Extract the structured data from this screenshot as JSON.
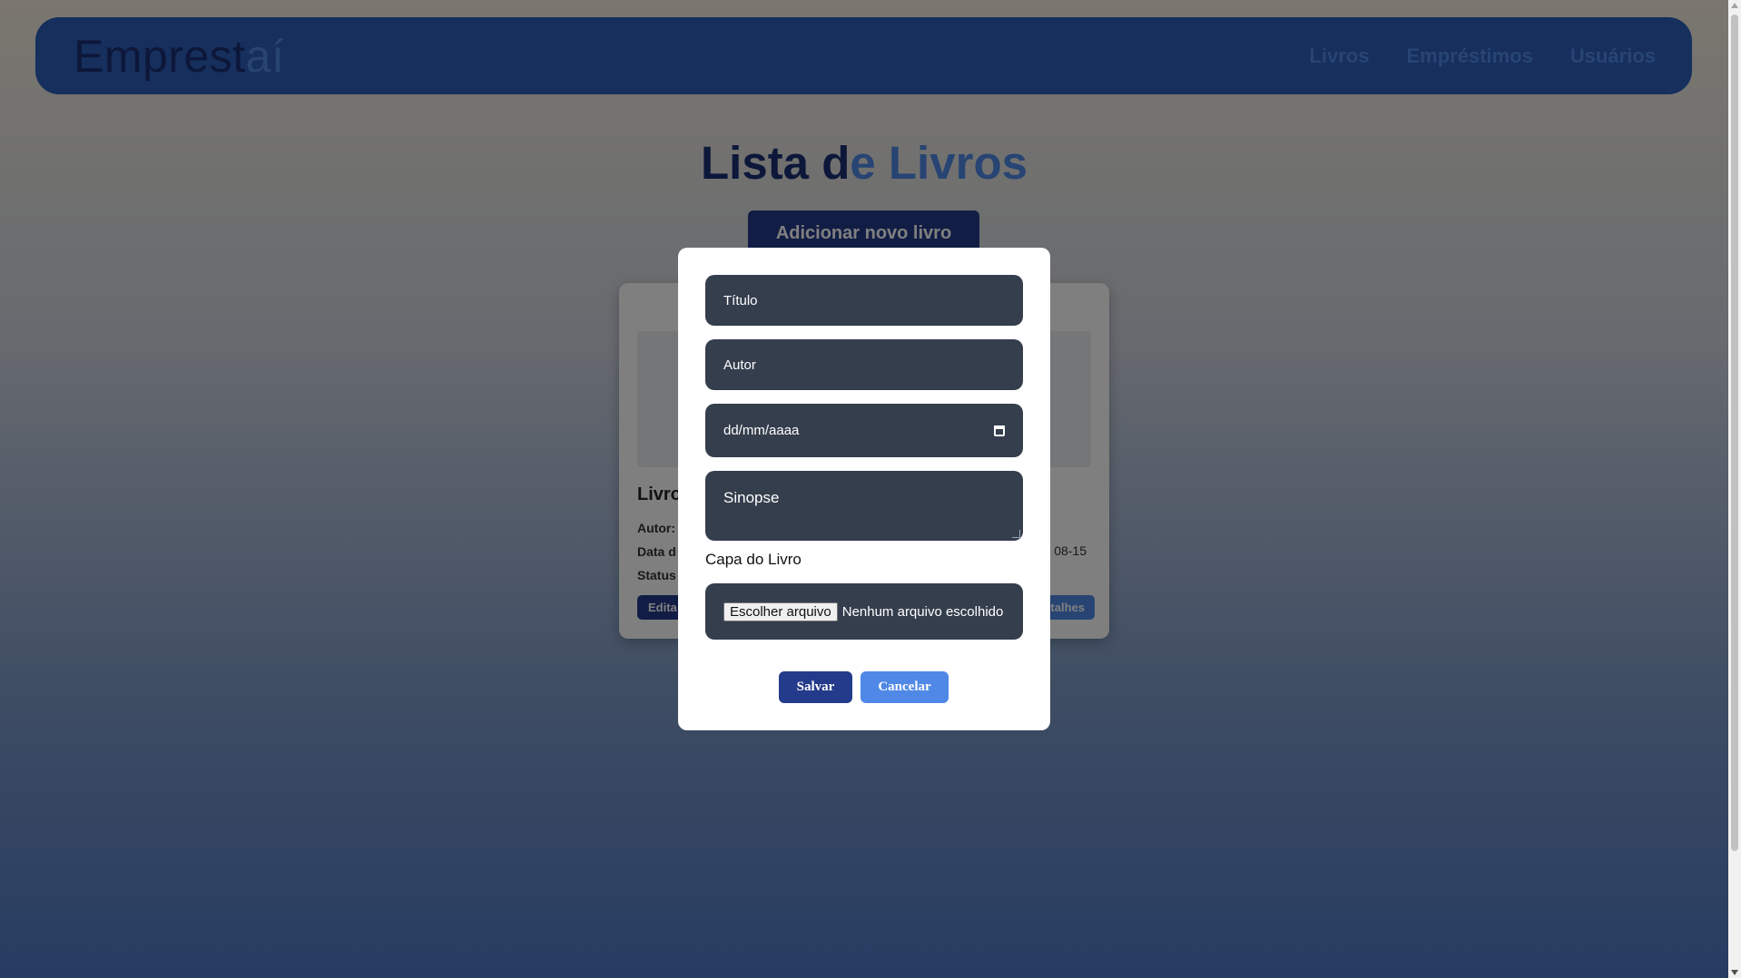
{
  "brand": {
    "logo_part1": "Emprest",
    "logo_part2": "aí"
  },
  "nav": {
    "items": [
      "Livros",
      "Empréstimos",
      "Usuários"
    ]
  },
  "main": {
    "title_part1": "Lista d",
    "title_part2": "e Livros",
    "add_button": "Adicionar novo livro"
  },
  "card": {
    "title": "Livro",
    "author_label": "Autor:",
    "date_label": "Data d",
    "date_value": "08-15",
    "status_label": "Status",
    "edit_button": "Edita",
    "details_button": "talhes"
  },
  "modal": {
    "title_placeholder": "Título",
    "author_placeholder": "Autor",
    "date_placeholder": "dd/mm/aaaa",
    "synopsis_placeholder": "Sinopse",
    "cover_label": "Capa do Livro",
    "file_button": "Escolher arquivo",
    "file_status": "Nenhum arquivo escolhido",
    "save_button": "Salvar",
    "cancel_button": "Cancelar"
  },
  "colors": {
    "navbar": "#2c5fba",
    "primary_dark": "#243a8a",
    "primary_light": "#4f88e6",
    "field_bg": "#353e4d"
  }
}
